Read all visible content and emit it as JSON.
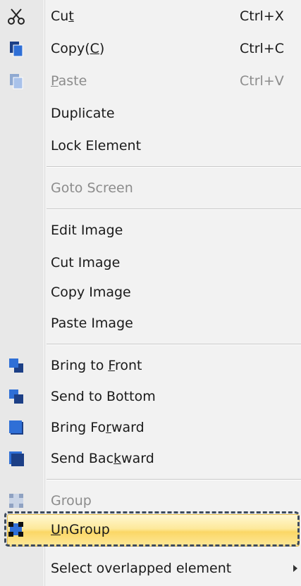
{
  "menu": {
    "items": [
      {
        "label": "Cut",
        "mnemonic": "t",
        "shortcut": "Ctrl+X",
        "icon": "scissors-icon",
        "enabled": true
      },
      {
        "label": "Copy(C)",
        "shortcut": "Ctrl+C",
        "icon": "copy-icon",
        "enabled": true
      },
      {
        "label": "Paste",
        "shortcut": "Ctrl+V",
        "icon": "paste-icon",
        "enabled": false
      },
      {
        "label": "Duplicate",
        "enabled": true
      },
      {
        "label": "Lock Element",
        "enabled": true
      },
      {
        "label": "Goto Screen",
        "enabled": false
      },
      {
        "label": "Edit Image",
        "enabled": true
      },
      {
        "label": "Cut Image",
        "enabled": true
      },
      {
        "label": "Copy Image",
        "enabled": true
      },
      {
        "label": "Paste Image",
        "enabled": true
      },
      {
        "label": "Bring to Front",
        "icon": "bring-to-front-icon",
        "enabled": true
      },
      {
        "label": "Send to Bottom",
        "icon": "send-to-bottom-icon",
        "enabled": true
      },
      {
        "label": "Bring Forward",
        "icon": "bring-forward-icon",
        "enabled": true
      },
      {
        "label": "Send Backward",
        "icon": "send-backward-icon",
        "enabled": true
      },
      {
        "label": "Group",
        "icon": "group-icon",
        "enabled": false
      },
      {
        "label": "UnGroup",
        "icon": "ungroup-icon",
        "enabled": true,
        "highlighted": true
      },
      {
        "label": "Select overlapped element",
        "enabled": true,
        "submenu": true
      }
    ]
  },
  "colors": {
    "highlight": "#fbd766",
    "icon_blue": "#2f6fd6",
    "icon_dark_blue": "#1c3f86",
    "disabled_text": "#8c8c8c"
  }
}
